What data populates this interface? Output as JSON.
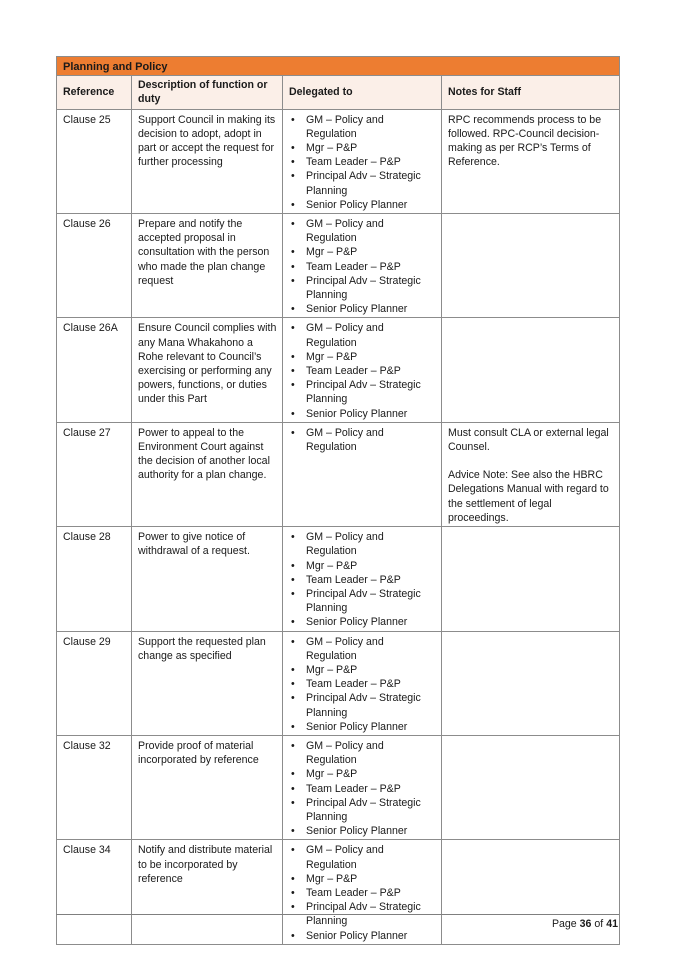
{
  "table": {
    "section_title": "Planning and Policy",
    "columns": {
      "reference": "Reference",
      "description": "Description of function or duty",
      "delegated_to": "Delegated to",
      "notes": "Notes for Staff"
    },
    "rows": [
      {
        "reference": "Clause 25",
        "description": "Support Council in making its decision to adopt, adopt in part or accept the request for further processing",
        "delegated_to": [
          "GM – Policy and Regulation",
          "Mgr – P&P",
          "Team Leader – P&P",
          "Principal Adv – Strategic Planning",
          "Senior Policy Planner"
        ],
        "notes": [
          "RPC recommends process to be followed. RPC-Council decision-making as per RCP’s Terms of Reference."
        ]
      },
      {
        "reference": "Clause 26",
        "description": "Prepare and notify the accepted proposal in consultation with the person who made the plan change request",
        "delegated_to": [
          "GM – Policy and Regulation",
          "Mgr – P&P",
          "Team Leader – P&P",
          "Principal Adv – Strategic Planning",
          "Senior Policy Planner"
        ],
        "notes": []
      },
      {
        "reference": "Clause 26A",
        "description": "Ensure Council complies with any Mana Whakahono a Rohe relevant to Council’s exercising or performing any powers, functions, or duties under this Part",
        "delegated_to": [
          "GM – Policy and Regulation",
          "Mgr – P&P",
          "Team Leader – P&P",
          "Principal Adv – Strategic Planning",
          "Senior Policy Planner"
        ],
        "notes": []
      },
      {
        "reference": "Clause 27",
        "description": "Power to appeal to the Environment Court against the decision of another local authority for a plan change.",
        "delegated_to": [
          "GM – Policy and Regulation"
        ],
        "notes": [
          "Must consult CLA or external legal Counsel.",
          "Advice Note: See also the HBRC Delegations Manual with regard to the settlement of legal proceedings."
        ]
      },
      {
        "reference": "Clause 28",
        "description": "Power to give notice of withdrawal of a request.",
        "delegated_to": [
          "GM – Policy and Regulation",
          "Mgr – P&P",
          "Team Leader – P&P",
          "Principal Adv – Strategic Planning",
          "Senior Policy Planner"
        ],
        "notes": []
      },
      {
        "reference": "Clause 29",
        "description": "Support the requested plan change as specified",
        "delegated_to": [
          "GM – Policy and Regulation",
          "Mgr – P&P",
          "Team Leader – P&P",
          "Principal Adv – Strategic Planning",
          "Senior Policy Planner"
        ],
        "notes": []
      },
      {
        "reference": "Clause 32",
        "description": "Provide proof of material incorporated by reference",
        "delegated_to": [
          "GM – Policy and Regulation",
          "Mgr – P&P",
          "Team Leader – P&P",
          "Principal Adv – Strategic Planning",
          "Senior Policy Planner"
        ],
        "notes": []
      },
      {
        "reference": "Clause 34",
        "description": "Notify and distribute material to be incorporated by reference",
        "delegated_to": [
          "GM – Policy and Regulation",
          "Mgr – P&P",
          "Team Leader – P&P",
          "Principal Adv – Strategic Planning",
          "Senior Policy Planner"
        ],
        "notes": []
      }
    ]
  },
  "footer": {
    "page_label": "Page",
    "page_current": "36",
    "page_of": "of",
    "page_total": "41"
  },
  "colors": {
    "section_header_bg": "#ed7d31",
    "column_header_bg": "#fbefe8",
    "border": "#8c8c8c"
  }
}
